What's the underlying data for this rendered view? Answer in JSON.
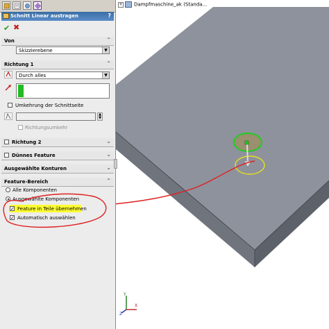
{
  "tree": {
    "part_name": "Dampfmaschine_ak  (Standa..."
  },
  "feature": {
    "title": "Schnitt Linear austragen",
    "help": "?",
    "ok_symbol": "✔",
    "cancel_symbol": "✖"
  },
  "von": {
    "header": "Von",
    "select_value": "Skizzierebene"
  },
  "richtung1": {
    "header": "Richtung 1",
    "select_value": "Durch alles",
    "flip_label": "Umkehrung der Schnittseite",
    "draft_label": "Richtungsumkehr"
  },
  "richtung2": {
    "header": "Richtung 2"
  },
  "duennes": {
    "header": "Dünnes Feature"
  },
  "konturen": {
    "header": "Ausgewählte Konturen"
  },
  "bereich": {
    "header": "Feature-Bereich",
    "radio_all": "Alle Komponenten",
    "radio_selected": "Ausgewählte Komponenten",
    "check_propagate": "Feature in Teile übernehmen",
    "check_auto": "Automatisch auswählen"
  },
  "triad": {
    "x": "X",
    "y": "Y",
    "z": "Z"
  },
  "colors": {
    "plate_top": "#8e929c",
    "plate_front": "#6f737c",
    "plate_side": "#5c6068",
    "annotation_red": "#e02020",
    "highlight_yellow": "#ffff33",
    "handle_green": "#22cc22"
  }
}
